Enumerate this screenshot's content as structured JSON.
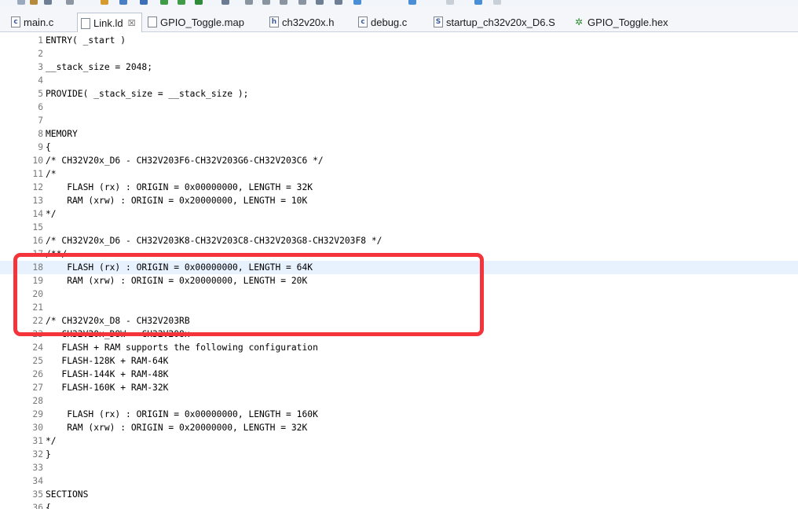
{
  "tabs": [
    {
      "label": "main.c",
      "icon": "c-file-icon",
      "active": false
    },
    {
      "label": "Link.ld",
      "icon": "ld-file-icon",
      "active": true
    },
    {
      "label": "GPIO_Toggle.map",
      "icon": "map-file-icon",
      "active": false
    },
    {
      "label": "ch32v20x.h",
      "icon": "h-file-icon",
      "active": false
    },
    {
      "label": "debug.c",
      "icon": "c-file-icon",
      "active": false
    },
    {
      "label": "startup_ch32v20x_D6.S",
      "icon": "s-file-icon",
      "active": false
    },
    {
      "label": "GPIO_Toggle.hex",
      "icon": "hex-file-icon",
      "active": false
    }
  ],
  "tab_close_glyph": "☒",
  "editor": {
    "current_line": 18,
    "lines": [
      {
        "n": "1",
        "text": "ENTRY( _start )"
      },
      {
        "n": "2",
        "text": ""
      },
      {
        "n": "3",
        "text": "__stack_size = 2048;"
      },
      {
        "n": "4",
        "text": ""
      },
      {
        "n": "5",
        "text": "PROVIDE( _stack_size = __stack_size );"
      },
      {
        "n": "6",
        "text": ""
      },
      {
        "n": "7",
        "text": ""
      },
      {
        "n": "8",
        "text": "MEMORY"
      },
      {
        "n": "9",
        "text": "{"
      },
      {
        "n": "10",
        "text": "/* CH32V20x_D6 - CH32V203F6-CH32V203G6-CH32V203C6 */"
      },
      {
        "n": "11",
        "text": "/*"
      },
      {
        "n": "12",
        "text": "    FLASH (rx) : ORIGIN = 0x00000000, LENGTH = 32K"
      },
      {
        "n": "13",
        "text": "    RAM (xrw) : ORIGIN = 0x20000000, LENGTH = 10K"
      },
      {
        "n": "14",
        "text": "*/"
      },
      {
        "n": "15",
        "text": ""
      },
      {
        "n": "16",
        "text": "/* CH32V20x_D6 - CH32V203K8-CH32V203C8-CH32V203G8-CH32V203F8 */"
      },
      {
        "n": "17",
        "text": "/**/"
      },
      {
        "n": "18",
        "text": "    FLASH (rx) : ORIGIN = 0x00000000, LENGTH = 64K"
      },
      {
        "n": "19",
        "text": "    RAM (xrw) : ORIGIN = 0x20000000, LENGTH = 20K"
      },
      {
        "n": "20",
        "text": ""
      },
      {
        "n": "21",
        "text": ""
      },
      {
        "n": "22",
        "text": "/* CH32V20x_D8 - CH32V203RB"
      },
      {
        "n": "23",
        "text": "   CH32V20x_D8W - CH32V208x"
      },
      {
        "n": "24",
        "text": "   FLASH + RAM supports the following configuration"
      },
      {
        "n": "25",
        "text": "   FLASH-128K + RAM-64K"
      },
      {
        "n": "26",
        "text": "   FLASH-144K + RAM-48K"
      },
      {
        "n": "27",
        "text": "   FLASH-160K + RAM-32K"
      },
      {
        "n": "28",
        "text": ""
      },
      {
        "n": "29",
        "text": "    FLASH (rx) : ORIGIN = 0x00000000, LENGTH = 160K"
      },
      {
        "n": "30",
        "text": "    RAM (xrw) : ORIGIN = 0x20000000, LENGTH = 32K"
      },
      {
        "n": "31",
        "text": "*/"
      },
      {
        "n": "32",
        "text": "}"
      },
      {
        "n": "33",
        "text": ""
      },
      {
        "n": "34",
        "text": ""
      },
      {
        "n": "35",
        "text": "SECTIONS"
      },
      {
        "n": "36",
        "text": "{"
      }
    ]
  },
  "colors": {
    "highlight_box": "#f5333a",
    "current_line_bg": "#e8f2fe",
    "line_number": "#787878"
  }
}
